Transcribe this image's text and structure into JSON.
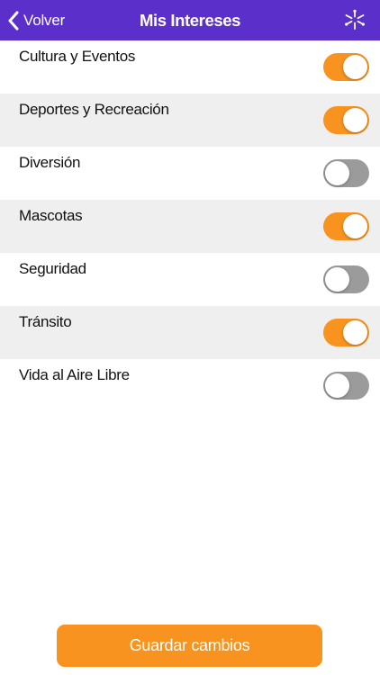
{
  "navbar": {
    "back_label": "Volver",
    "title": "Mis Intereses",
    "background": "#5b2fc9",
    "logo_icon": "sparkle-logo-icon"
  },
  "interests": [
    {
      "label": "Cultura y Eventos",
      "enabled": true
    },
    {
      "label": "Deportes y Recreación",
      "enabled": true
    },
    {
      "label": "Diversión",
      "enabled": false
    },
    {
      "label": "Mascotas",
      "enabled": true
    },
    {
      "label": "Seguridad",
      "enabled": false
    },
    {
      "label": "Tránsito",
      "enabled": true
    },
    {
      "label": "Vida al Aire Libre",
      "enabled": false
    }
  ],
  "save_button": {
    "label": "Guardar cambios"
  },
  "colors": {
    "accent": "#f7931e",
    "toggle_off": "#9b9b9b",
    "alt_row": "#efefef"
  }
}
